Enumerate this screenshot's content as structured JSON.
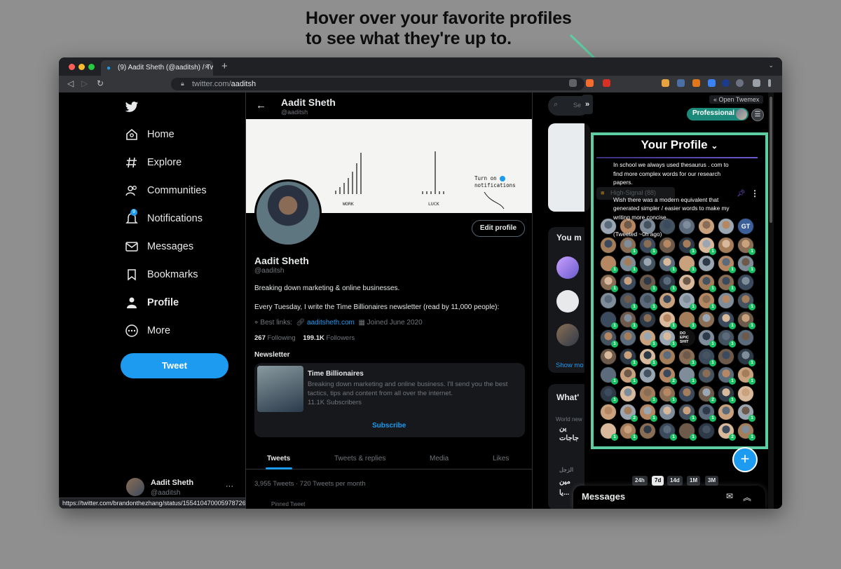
{
  "headline": {
    "line1": "Hover over your favorite profiles",
    "line2": "to see what they're up to."
  },
  "browser": {
    "tab_title": "(9) Aadit Sheth (@aaditsh) / Tw",
    "url_host": "twitter.com/",
    "url_path": "aaditsh",
    "status_url": "https://twitter.com/brandonthezhang/status/1554104700059787265"
  },
  "sidebar": {
    "items": [
      {
        "label": "Home"
      },
      {
        "label": "Explore"
      },
      {
        "label": "Communities"
      },
      {
        "label": "Notifications",
        "badge": "9"
      },
      {
        "label": "Messages"
      },
      {
        "label": "Bookmarks"
      },
      {
        "label": "Profile"
      },
      {
        "label": "More"
      }
    ],
    "tweet_button": "Tweet",
    "account_name": "Aadit Sheth",
    "account_handle": "@aaditsh",
    "more_dots": "···"
  },
  "profile": {
    "header_name": "Aadit Sheth",
    "header_handle": "@aaditsh",
    "banner_work": "WORK",
    "banner_luck": "LUCK",
    "banner_turn_on": "Turn on",
    "banner_notifications": "notifications",
    "edit_button": "Edit profile",
    "name": "Aadit Sheth",
    "handle": "@aaditsh",
    "bio": "Breaking down marketing & online businesses.",
    "bio2": "Every Tuesday, I write the Time Billionaires newsletter (read by 11,000 people):",
    "best_links_label": "Best links:",
    "best_links_url": "aaditsheth.com",
    "joined": "Joined June 2020",
    "following_count": "267",
    "following_label": "Following",
    "followers_count": "199.1K",
    "followers_label": "Followers",
    "newsletter_heading": "Newsletter",
    "newsletter_name": "Time Billionaires",
    "newsletter_desc": "Breaking down marketing and online business. I'll send you the best tactics, tips and content from all over the internet.",
    "newsletter_subs": "11.1K Subscribers",
    "subscribe": "Subscribe",
    "tabs": [
      "Tweets",
      "Tweets & replies",
      "Media",
      "Likes"
    ],
    "tweet_count": "3,955 Tweets · 720 Tweets per month",
    "pinned": "Pinned Tweet"
  },
  "right": {
    "search_placeholder": "Se",
    "you_might": "You m",
    "show_more": "Show mo",
    "whats": "What'",
    "world_news": "World new",
    "arab1": "ين",
    "arab2": "جاجات",
    "arab3": "الزجل",
    "arab4": "مين",
    "arab5": "يا..."
  },
  "twemex": {
    "collapse_label": "»",
    "open_label": "« Open Twemex",
    "professional": "Professional",
    "menu": "☰",
    "panel_title": "Your Profile",
    "panel_title_caret": "⌄",
    "high_signal": "High-Signal (88)",
    "tooltip_p1": "In school we always used thesaurus . com to find more complex words for our research papers.",
    "tooltip_p2": "Wish there was a modern equivalent that generated simpler / easier words to make my writing more concise.",
    "tooltip_p3": "(Tweeted ~0h ago)",
    "gt_label": "GT",
    "do_epic_label": "DO EPIC SHIT",
    "fab": "+",
    "ranges": [
      "24h",
      "7d",
      "14d",
      "1M",
      "3M"
    ],
    "active_range": "7d"
  },
  "messages_title": "Messages",
  "colors": {
    "accent": "#1d9bf0",
    "panel_border": "#5dcea2",
    "badge_green": "#17bf63",
    "professional": "#1b8a7a"
  }
}
